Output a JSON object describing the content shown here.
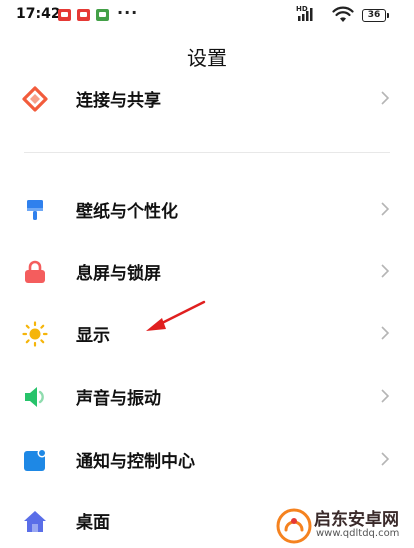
{
  "status_bar": {
    "time": "17:42",
    "more": "···",
    "signal_label": "HD",
    "battery": "36"
  },
  "header": {
    "title": "设置"
  },
  "settings": [
    {
      "label": "连接与共享",
      "icon": "share-diamond-icon",
      "color": "#f25c3c"
    },
    {
      "label": "壁纸与个性化",
      "icon": "paint-brush-icon",
      "color": "#2f80ed"
    },
    {
      "label": "息屏与锁屏",
      "icon": "lock-icon",
      "color": "#f45d5d"
    },
    {
      "label": "显示",
      "icon": "sun-icon",
      "color": "#f5b50a"
    },
    {
      "label": "声音与振动",
      "icon": "speaker-icon",
      "color": "#27c36a"
    },
    {
      "label": "通知与控制中心",
      "icon": "notification-icon",
      "color": "#1e88e5"
    },
    {
      "label": "桌面",
      "icon": "home-icon",
      "color": "#5a6ee8"
    }
  ],
  "watermark": {
    "title": "启东安卓网",
    "url": "www.qdltdq.com"
  },
  "colors": {
    "annotation_arrow": "#e02020",
    "chevron": "#b5b5b5"
  }
}
